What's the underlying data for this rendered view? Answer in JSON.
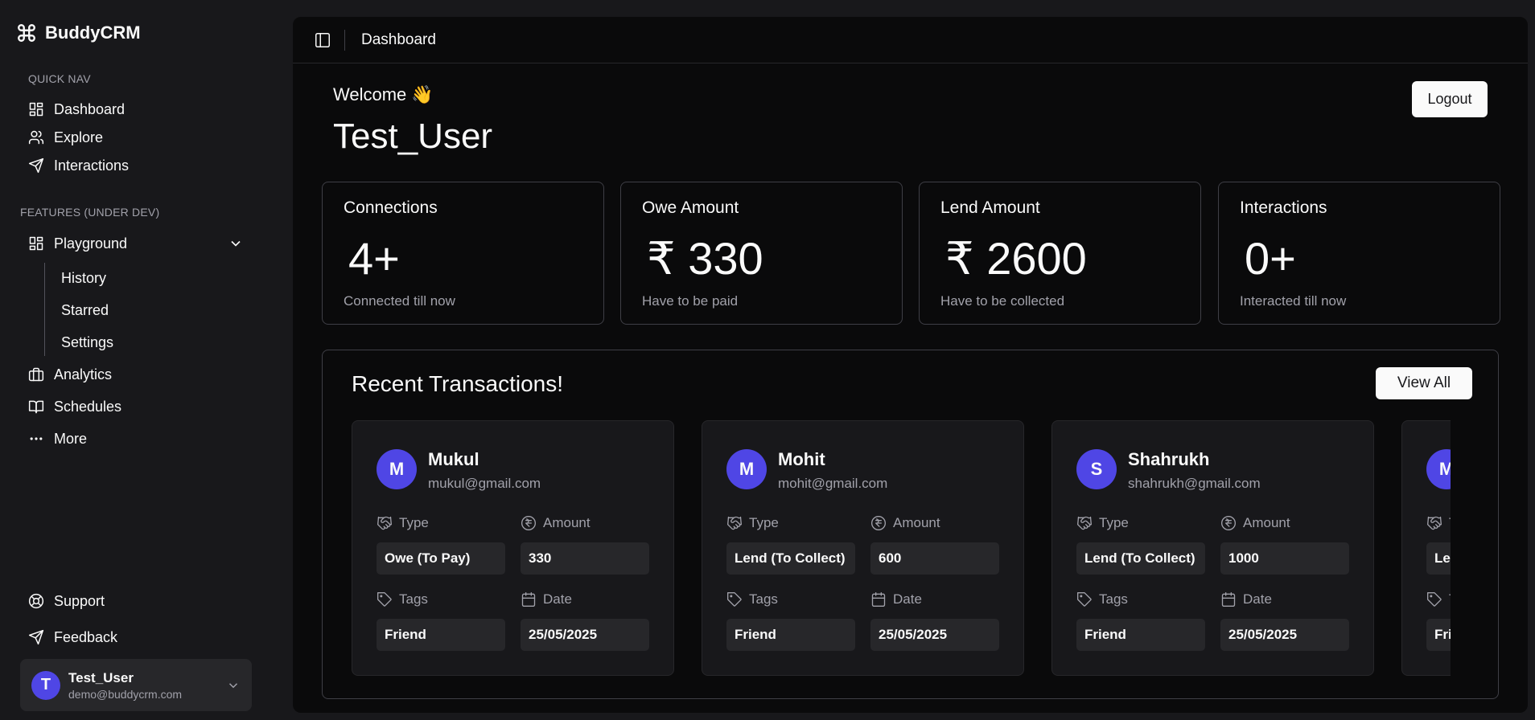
{
  "brand": {
    "name": "BuddyCRM"
  },
  "sidebar": {
    "quick_nav_label": "QUICK NAV",
    "quick_nav": [
      {
        "label": "Dashboard",
        "icon": "grid-icon"
      },
      {
        "label": "Explore",
        "icon": "users-icon"
      },
      {
        "label": "Interactions",
        "icon": "send-icon"
      }
    ],
    "features_label": "FEATURES (UNDER DEV)",
    "playground_label": "Playground",
    "playground_sub": [
      "History",
      "Starred",
      "Settings"
    ],
    "features": [
      {
        "label": "Analytics",
        "icon": "briefcase-icon"
      },
      {
        "label": "Schedules",
        "icon": "book-icon"
      },
      {
        "label": "More",
        "icon": "more-icon"
      }
    ],
    "support_label": "Support",
    "feedback_label": "Feedback",
    "user": {
      "initial": "T",
      "name": "Test_User",
      "email": "demo@buddycrm.com"
    }
  },
  "header": {
    "title": "Dashboard"
  },
  "main": {
    "welcome": "Welcome 👋",
    "username": "Test_User",
    "logout_label": "Logout",
    "stats": [
      {
        "title": "Connections",
        "value": "4+",
        "sub": "Connected till now"
      },
      {
        "title": "Owe Amount",
        "value": "₹ 330",
        "sub": "Have to be paid"
      },
      {
        "title": "Lend Amount",
        "value": "₹ 2600",
        "sub": "Have to be collected"
      },
      {
        "title": "Interactions",
        "value": "0+",
        "sub": "Interacted till now"
      }
    ],
    "recent": {
      "title": "Recent Transactions!",
      "view_all_label": "View All",
      "labels": {
        "type": "Type",
        "amount": "Amount",
        "tags": "Tags",
        "date": "Date"
      },
      "transactions": [
        {
          "initial": "M",
          "name": "Mukul",
          "email": "mukul@gmail.com",
          "type": "Owe (To Pay)",
          "amount": "330",
          "tags": "Friend",
          "date": "25/05/2025"
        },
        {
          "initial": "M",
          "name": "Mohit",
          "email": "mohit@gmail.com",
          "type": "Lend (To Collect)",
          "amount": "600",
          "tags": "Friend",
          "date": "25/05/2025"
        },
        {
          "initial": "S",
          "name": "Shahrukh",
          "email": "shahrukh@gmail.com",
          "type": "Lend (To Collect)",
          "amount": "1000",
          "tags": "Friend",
          "date": "25/05/2025"
        },
        {
          "initial": "M",
          "name": "",
          "email": "",
          "type": "Lend (To Collect)",
          "amount": "",
          "tags": "Friend",
          "date": ""
        }
      ]
    }
  },
  "colors": {
    "accent": "#4f46e5",
    "background": "#0a0a0b",
    "sidebar": "#18181b",
    "muted_text": "#a1a1aa"
  }
}
